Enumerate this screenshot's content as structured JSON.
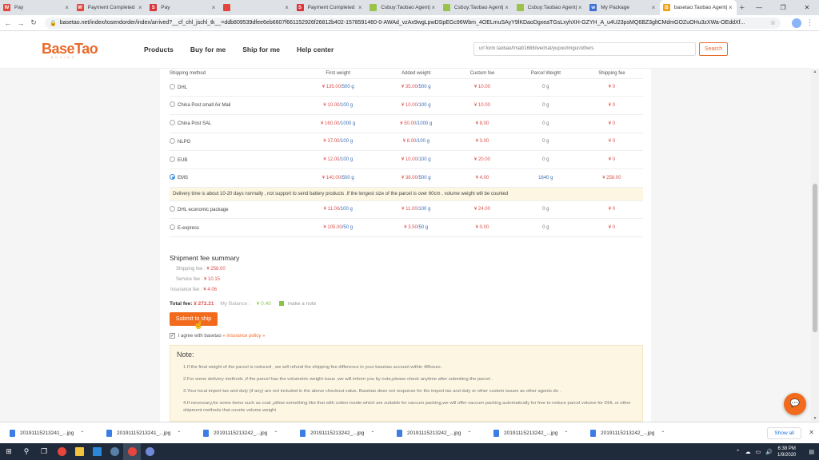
{
  "tabs": [
    {
      "title": "Pay",
      "fav_color": "#e0463c",
      "fav_letter": "W"
    },
    {
      "title": "Payment Completed",
      "fav_color": "#e0463c",
      "fav_letter": "W"
    },
    {
      "title": "Pay",
      "fav_color": "#d9353b",
      "fav_letter": "S"
    },
    {
      "title": "",
      "fav_color": "#e0463c",
      "fav_letter": ""
    },
    {
      "title": "Payment Completed",
      "fav_color": "#d9353b",
      "fav_letter": "S"
    },
    {
      "title": "Csbuy:Taobao Agent|",
      "fav_color": "#9bc24a",
      "fav_letter": ""
    },
    {
      "title": "Csbuy:Taobao Agent|",
      "fav_color": "#9bc24a",
      "fav_letter": ""
    },
    {
      "title": "Csbuy:Taobao Agent|",
      "fav_color": "#9bc24a",
      "fav_letter": ""
    },
    {
      "title": "My Package",
      "fav_color": "#3b6fd6",
      "fav_letter": "w"
    },
    {
      "title": "basetao:Taobao Agent|",
      "fav_color": "#f2a21d",
      "fav_letter": "B",
      "active": true
    }
  ],
  "address": {
    "url": "basetao.net/index/tosendorder/index/arrived?__cf_chl_jschl_tk__=ddb809539dfee6eb6607f661152926f26812b402-1578591460-0-AWAd_vzAx9wgLpwDSpEGc96Wbm_4OELmuSAyY9lKDaoDgxeaTGsLxyhXH-GZYH_A_u4U23psMQ6BZ3gltCMdmGOZuOHu3zXWa-OEddXf..."
  },
  "site": {
    "logo": "BaseTao",
    "logo_sub": "BUYING",
    "nav": [
      "Products",
      "Buy for me",
      "Ship for me",
      "Help center"
    ],
    "search_placeholder": "url form taobao/tmall/1688/wechat/yupoo/imgur/others",
    "search_button": "Search"
  },
  "shipping": {
    "headers": [
      "Shipping method",
      "First weight",
      "Added weight",
      "Custom fee",
      "Parcel Weight",
      "Shipping fee"
    ],
    "rows": [
      {
        "method": "DHL",
        "first_price": "¥ 135.00",
        "first_unit": "/500 g",
        "added_price": "¥ 35.00",
        "added_unit": "/500 g",
        "custom": "¥ 10.00",
        "weight": "0 g",
        "fee": "¥ 0"
      },
      {
        "method": "China Post small Air Mail",
        "first_price": "¥ 10.00",
        "first_unit": "/100 g",
        "added_price": "¥ 10.00",
        "added_unit": "/100 g",
        "custom": "¥ 10.00",
        "weight": "0 g",
        "fee": "¥ 0"
      },
      {
        "method": "China Post SAL",
        "first_price": "¥ 160.00",
        "first_unit": "/1000 g",
        "added_price": "¥ 50.00",
        "added_unit": "/1000 g",
        "custom": "¥ 8.00",
        "weight": "0 g",
        "fee": "¥ 0"
      },
      {
        "method": "NLPG",
        "first_price": "¥ 37.00",
        "first_unit": "/100 g",
        "added_price": "¥ 8.00",
        "added_unit": "/100 g",
        "custom": "¥ 0.00",
        "weight": "0 g",
        "fee": "¥ 0"
      },
      {
        "method": "EUB",
        "first_price": "¥ 12.00",
        "first_unit": "/100 g",
        "added_price": "¥ 10.00",
        "added_unit": "/100 g",
        "custom": "¥ 20.00",
        "weight": "0 g",
        "fee": "¥ 0"
      },
      {
        "method": "EMS",
        "first_price": "¥ 140.00",
        "first_unit": "/500 g",
        "added_price": "¥ 38.00",
        "added_unit": "/500 g",
        "custom": "¥ 4.00",
        "weight": "1640 g",
        "fee": "¥ 258.00",
        "selected": true
      },
      {
        "method": "DHL economic package",
        "first_price": "¥ 11.00",
        "first_unit": "/100 g",
        "added_price": "¥ 11.00",
        "added_unit": "/100 g",
        "custom": "¥ 24.00",
        "weight": "0 g",
        "fee": "¥ 0"
      },
      {
        "method": "E-express",
        "first_price": "¥ 105.00",
        "first_unit": "/50 g",
        "added_price": "¥ 3.50",
        "added_unit": "/50 g",
        "custom": "¥ 0.00",
        "weight": "0 g",
        "fee": "¥ 0"
      }
    ],
    "ems_notice": "Delivery time is about 10-20 days normally , not support to send battery products .If the longest size of the parcel is over 60cm , volume weight will be counted"
  },
  "summary": {
    "title": "Shipment fee summary",
    "shipping_label": "Shipping fee :",
    "shipping_value": "¥ 258.00",
    "service_label": "Service fee :",
    "service_value": "¥ 10.15",
    "insurance_label": "Insurance fee :",
    "insurance_value": "¥ 4.06",
    "total_label": "Total fee:",
    "total_value": "¥ 272.21",
    "balance_label": "My Balance :",
    "balance_value": "¥ 0.40",
    "note_label": "make a note",
    "submit_label": "Submit to ship",
    "agree_text": "I agree with basetao",
    "agree_link": "« insurance policy »"
  },
  "notes": {
    "title": "Note:",
    "items": [
      "1.If the final weight of the parcel is reduced , we will refund the shipping fee difference in your basetao account within 48hours .",
      "2.For some delivery methods ,if the parcel has the volumetric weight issue ,we will inform you by note,please check anytime after submiting the parcel .",
      "3.Your local import tax and duty (if any) are not included in the above checkout value. Basetao does not response for the import tax and duty or other custom issues as other agents do .",
      "4.If necessary,for some items such as coat ,pillow something like that with cotton inside which are suitable for vaccum packing,we will offer vaccum packing automatically for free to reduce parcel volume for DHL or other shipment methods that counts volume weight"
    ]
  },
  "downloads": {
    "items": [
      "20191115213241_...jpg",
      "20191115213241_...jpg",
      "20191115213242_...jpg",
      "20191115213242_...jpg",
      "20191115213242_...jpg",
      "20191115213242_...jpg",
      "20191115213242_...jpg"
    ],
    "show_all": "Show all"
  },
  "taskbar": {
    "time": "6:38 PM",
    "date": "1/9/2020"
  }
}
